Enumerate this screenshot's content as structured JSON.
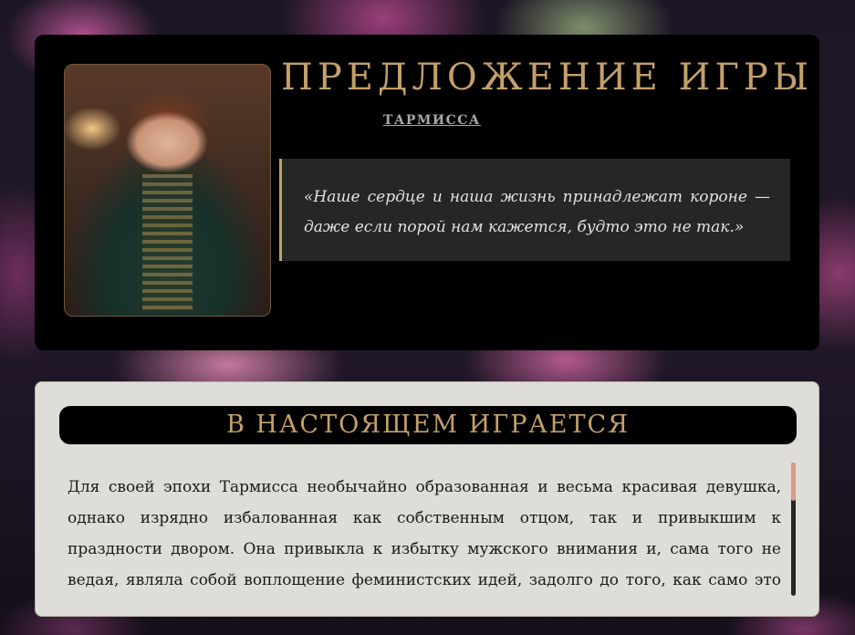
{
  "header": {
    "title": "ПРЕДЛОЖЕНИЕ ИГРЫ",
    "author": "ТАРМИССА",
    "portrait_icon": "portrait-image"
  },
  "quote": {
    "text": "«Наше сердце и наша жизнь принадлежат короне — даже если порой нам кажется, будто это не так.»"
  },
  "playing": {
    "title": "В НАСТОЯЩЕМ ИГРАЕТСЯ",
    "text": "Для своей эпохи Тармисса необычайно образованная и весьма красивая девушка, однако изрядно избалованная как собственным отцом, так и привыкшим к праздности двором. Она привыкла к избытку мужского внимания и, сама того не ведая, являла собой воплощение феминистских идей, задолго до того, как само это понятие появилось"
  },
  "colors": {
    "accent_gold": "#c4a06a",
    "card_dark": "#000000",
    "card_light": "#deddd8",
    "scroll_thumb": "#d89a86"
  }
}
